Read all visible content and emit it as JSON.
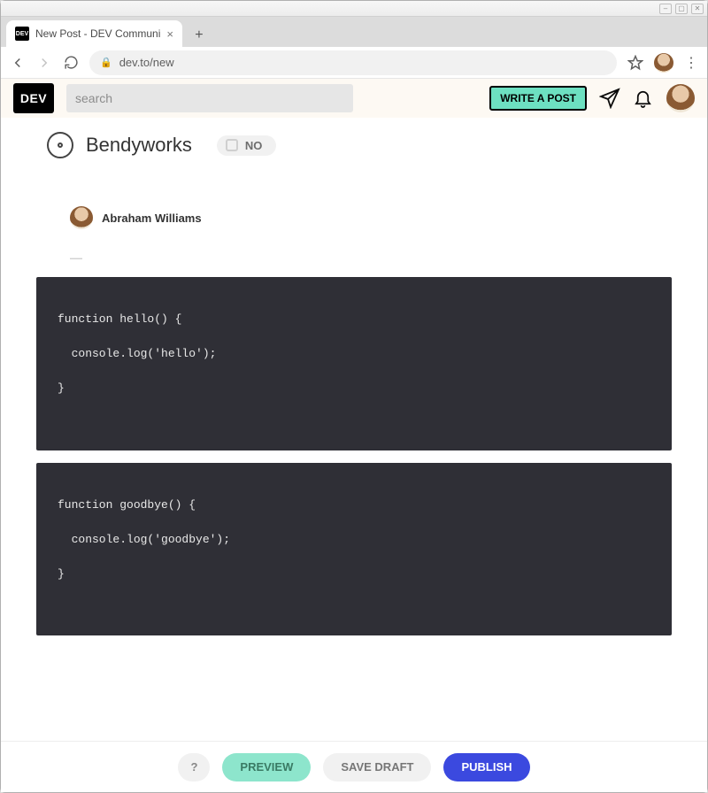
{
  "window": {
    "tab_title": "New Post - DEV Communi",
    "url": "dev.to/new"
  },
  "header": {
    "logo_text": "DEV",
    "search_placeholder": "search",
    "write_post_label": "WRITE A POST"
  },
  "org": {
    "name": "Bendyworks",
    "toggle_label": "NO"
  },
  "author": {
    "name": "Abraham Williams"
  },
  "code_blocks": [
    "function hello() {\n\n  console.log('hello');\n\n}",
    "function goodbye() {\n\n  console.log('goodbye');\n\n}"
  ],
  "footer": {
    "help_label": "?",
    "preview_label": "PREVIEW",
    "save_draft_label": "SAVE DRAFT",
    "publish_label": "PUBLISH"
  }
}
